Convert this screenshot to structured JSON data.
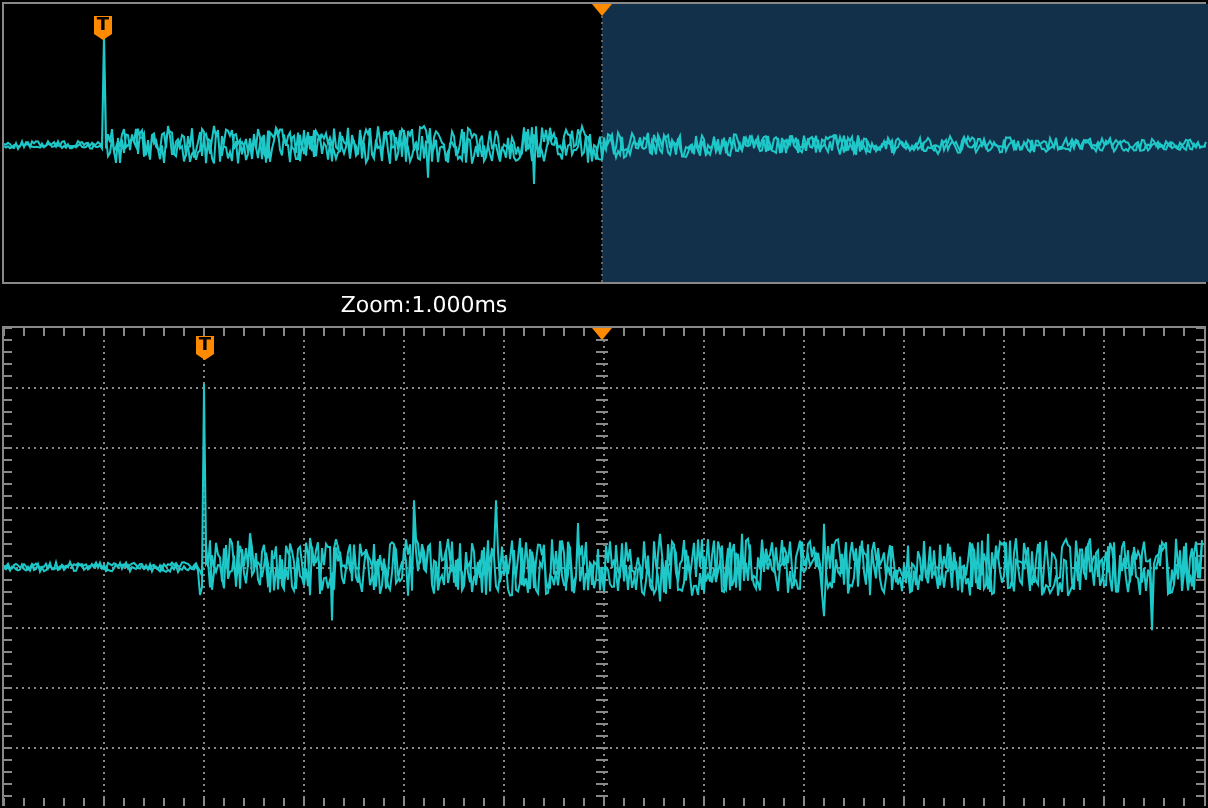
{
  "overview": {
    "trigger_label": "T"
  },
  "zoom_label": "Zoom:1.000ms",
  "zoom_view": {
    "trigger_label": "T"
  }
}
